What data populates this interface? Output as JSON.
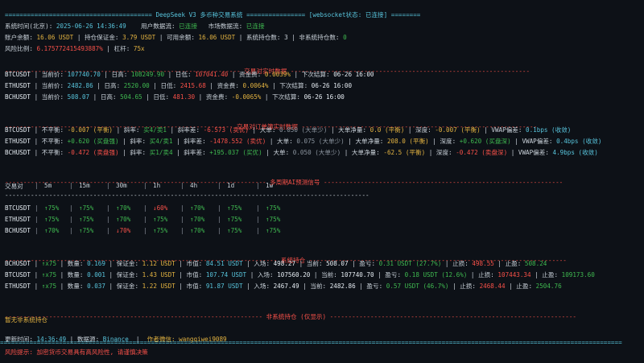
{
  "header": {
    "left_rule": "========================================",
    "title": "DeepSeek V3 多币种交易系统",
    "mid_rule": "================",
    "ws_status": "[websocket状态: 已连接]",
    "right_rule": "========"
  },
  "status": {
    "time_label": "系统时间(北京):",
    "time_value": "2025-06-26 14:36:49",
    "user_data_label": "用户数据流:",
    "user_data_value": "已连接",
    "market_data_label": "市场数据流:",
    "market_data_value": "已连接"
  },
  "account": {
    "balance_label": "账户余额:",
    "balance_value": "16.06 USDT",
    "margin_label": "持仓保证金:",
    "margin_value": "3.79 USDT",
    "available_label": "可用余额:",
    "available_value": "16.06 USDT",
    "sys_pos_label": "系统持仓数:",
    "sys_pos_value": "3",
    "nonsys_pos_label": "非系统持仓数:",
    "nonsys_pos_value": "0",
    "risk_label": "风险比例:",
    "risk_value": "6.175772415493887%",
    "leverage_label": "杠杆:",
    "leverage_value": "75x"
  },
  "realtime": {
    "header": "交易对实时数据",
    "rows": [
      {
        "symbol": "BTCUSDT",
        "price": "107740.70",
        "high": "108249.90",
        "low": "107041.40",
        "funding": "0.0039%",
        "next": "06-26 16:00"
      },
      {
        "symbol": "ETHUSDT",
        "price": "2482.86",
        "high": "2520.00",
        "low": "2415.68",
        "funding": "0.0064%",
        "next": "06-26 16:00"
      },
      {
        "symbol": "BCHUSDT",
        "price": "508.07",
        "high": "504.65",
        "low": "481.30",
        "funding": "-0.0065%",
        "next": "06-26 16:00"
      }
    ],
    "labels": {
      "price": "当前价:",
      "high": "日高:",
      "low": "日低:",
      "funding": "资金费:",
      "next": "下次结算:"
    }
  },
  "orderflow": {
    "header": "交易对订单簿实时数据",
    "rows": [
      {
        "symbol": "BTCUSDT",
        "imb": "-0.007 (平衡)",
        "slope": "买4/卖1",
        "slope_diff": "-6.573 (卖优)",
        "big": "0.050 (大单少)",
        "big_net": "0.0 (平衡)",
        "depth": "-0.007 (平衡)",
        "vwap": "0.1bps (收敛)"
      },
      {
        "symbol": "ETHUSDT",
        "imb": "+0.620 (买盘强)",
        "slope": "买4/卖1",
        "slope_diff": "-1478.552 (卖优)",
        "big": "0.075 (大单少)",
        "big_net": "208.0 (平衡)",
        "depth": "+0.620 (买盘深)",
        "vwap": "0.4bps (收敛)"
      },
      {
        "symbol": "BCHUSDT",
        "imb": "-0.472 (卖盘强)",
        "slope": "买1/卖4",
        "slope_diff": "+195.037 (买优)",
        "big": "0.050 (大单少)",
        "big_net": "-62.5 (平衡)",
        "depth": "-0.472 (卖盘深)",
        "vwap": "4.9bps (收敛)"
      }
    ],
    "labels": {
      "imb": "不平衡:",
      "slope": "斜率:",
      "slope_diff": "斜率差:",
      "big": "大单:",
      "big_net": "大单净量:",
      "depth": "深度:",
      "vwap": "VWAP偏差:"
    }
  },
  "ai_signals": {
    "header": "多周期AI预测信号",
    "columns": [
      "交易对",
      "5m",
      "15m",
      "30m",
      "1h",
      "4h",
      "1d",
      "1w"
    ],
    "rows": [
      {
        "symbol": "BTCUSDT",
        "cells": [
          "↑75%",
          "↑75%",
          "↑70%",
          "↓60%",
          "↑70%",
          "↑75%",
          "↑75%"
        ]
      },
      {
        "symbol": "ETHUSDT",
        "cells": [
          "↑75%",
          "↑75%",
          "↑70%",
          "↑75%",
          "↑70%",
          "↑75%",
          "↑75%"
        ]
      },
      {
        "symbol": "BCHUSDT",
        "cells": [
          "↑70%",
          "↑75%",
          "↓70%",
          "↑75%",
          "↑70%",
          "↑75%",
          "↑75%"
        ]
      }
    ]
  },
  "positions": {
    "header": "系统持仓",
    "rows": [
      {
        "symbol": "BCHUSDT",
        "lev": "↑x75",
        "qty": "0.169",
        "margin": "1.12 USDT",
        "value": "84.51 USDT",
        "entry": "498.27",
        "current": "508.07",
        "pnl": "0.31 USDT (27.7%)",
        "sl": "498.55",
        "tp": "508.24"
      },
      {
        "symbol": "BTCUSDT",
        "lev": "↑x75",
        "qty": "0.001",
        "margin": "1.43 USDT",
        "value": "107.74 USDT",
        "entry": "107560.20",
        "current": "107740.70",
        "pnl": "0.18 USDT (12.6%)",
        "sl": "107443.34",
        "tp": "109173.60"
      },
      {
        "symbol": "ETHUSDT",
        "lev": "↑x75",
        "qty": "0.037",
        "margin": "1.22 USDT",
        "value": "91.87 USDT",
        "entry": "2467.49",
        "current": "2482.86",
        "pnl": "0.57 USDT (46.7%)",
        "sl": "2468.44",
        "tp": "2504.76"
      }
    ],
    "labels": {
      "qty": "数量:",
      "margin": "保证金:",
      "value": "市值:",
      "entry": "入场:",
      "current": "当前:",
      "pnl": "盈亏:",
      "sl": "止损:",
      "tp": "止盈:"
    }
  },
  "nonsystem": {
    "header": "非系统持仓 (仅显示)",
    "empty_text": "暂无非系统持仓",
    "update_label": "更新时间:",
    "update_value": "14:36:49",
    "source_label": "数据源:",
    "source_value": "Binance",
    "author_label": "作者微信:",
    "author_value": "wangqiwei9089"
  },
  "footer": {
    "warning": "风险提示: 加密货币交易具有高风险性, 请谨慎决策"
  },
  "colors": {
    "bg": "#0d1117",
    "cyan": "#58c4dc",
    "green": "#3fb950",
    "red": "#f85149",
    "yellow": "#e3b341"
  }
}
